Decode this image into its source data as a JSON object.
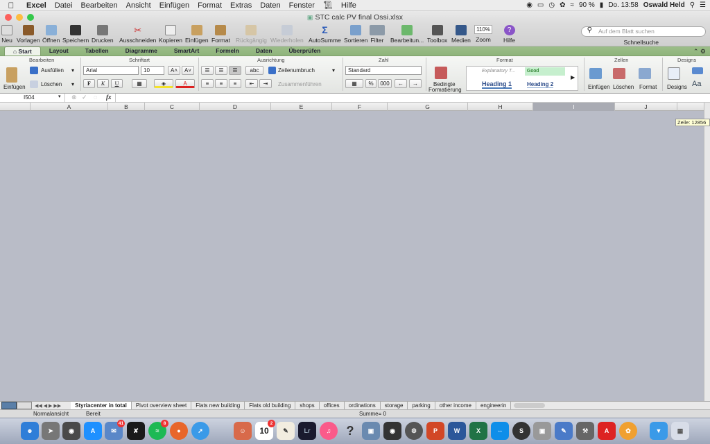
{
  "menubar": {
    "app": "Excel",
    "items": [
      "Datei",
      "Bearbeiten",
      "Ansicht",
      "Einfügen",
      "Format",
      "Extras",
      "Daten",
      "Fenster",
      "Hilfe"
    ],
    "battery": "90 %",
    "clock": "Do. 13:58",
    "user": "Oswald Held"
  },
  "window": {
    "title": "STC calc PV final Ossi.xlsx"
  },
  "toolbar": {
    "new": "Neu",
    "templates": "Vorlagen",
    "open": "Öffnen",
    "save": "Speichern",
    "print": "Drucken",
    "cut": "Ausschneiden",
    "copy": "Kopieren",
    "paste": "Einfügen",
    "format": "Format",
    "undo": "Rückgängig",
    "redo": "Wiederholen",
    "autosum": "AutoSumme",
    "sort": "Sortieren",
    "filter": "Filter",
    "edit": "Bearbeitun...",
    "toolbox": "Toolbox",
    "media": "Medien",
    "zoom": "Zoom",
    "zoom_value": "110%",
    "help": "Hilfe",
    "search_placeholder": "Auf dem Blatt suchen",
    "quicksearch": "Schnellsuche"
  },
  "ribbon_tabs": [
    "Start",
    "Layout",
    "Tabellen",
    "Diagramme",
    "SmartArt",
    "Formeln",
    "Daten",
    "Überprüfen"
  ],
  "ribbon": {
    "g_edit": "Bearbeiten",
    "g_font": "Schriftart",
    "g_align": "Ausrichtung",
    "g_number": "Zahl",
    "g_format": "Format",
    "g_cells": "Zellen",
    "g_designs": "Designs",
    "paste": "Einfügen",
    "fill": "Ausfüllen",
    "clear": "Löschen",
    "font": "Arial",
    "size": "10",
    "wrap": "Zeilenumbruch",
    "merge": "Zusammenführen",
    "number_format": "Standard",
    "percent": "%",
    "thousands": "000",
    "conditional1": "Bedingte",
    "conditional2": "Formatierung",
    "style_explanatory": "Explanatory T...",
    "style_good": "Good",
    "style_h1": "Heading 1",
    "style_h2": "Heading 2",
    "insert": "Einfügen",
    "delete": "Löschen",
    "format_cells": "Format",
    "designs": "Designs",
    "abc": "abc",
    "bold": "F",
    "italic": "K",
    "underline": "U"
  },
  "formula_bar": {
    "cell_ref": "I504",
    "fx": "fx"
  },
  "columns": [
    "A",
    "B",
    "C",
    "D",
    "E",
    "F",
    "G",
    "H",
    "I",
    "J"
  ],
  "tooltip": "Zeile: 12856",
  "sheets": [
    "Styriacenter in total",
    "Pivot overview sheet",
    "Flats new building",
    "Flats old building",
    "shops",
    "offices",
    "ordinations",
    "storage",
    "parking",
    "other income",
    "engineerin"
  ],
  "status": {
    "view": "Normalansicht",
    "ready": "Bereit",
    "sum": "Summe= 0"
  },
  "dock": {
    "badge_mail": "41",
    "badge_spotify": "8",
    "badge_calendar": "2",
    "calendar_day": "10"
  }
}
